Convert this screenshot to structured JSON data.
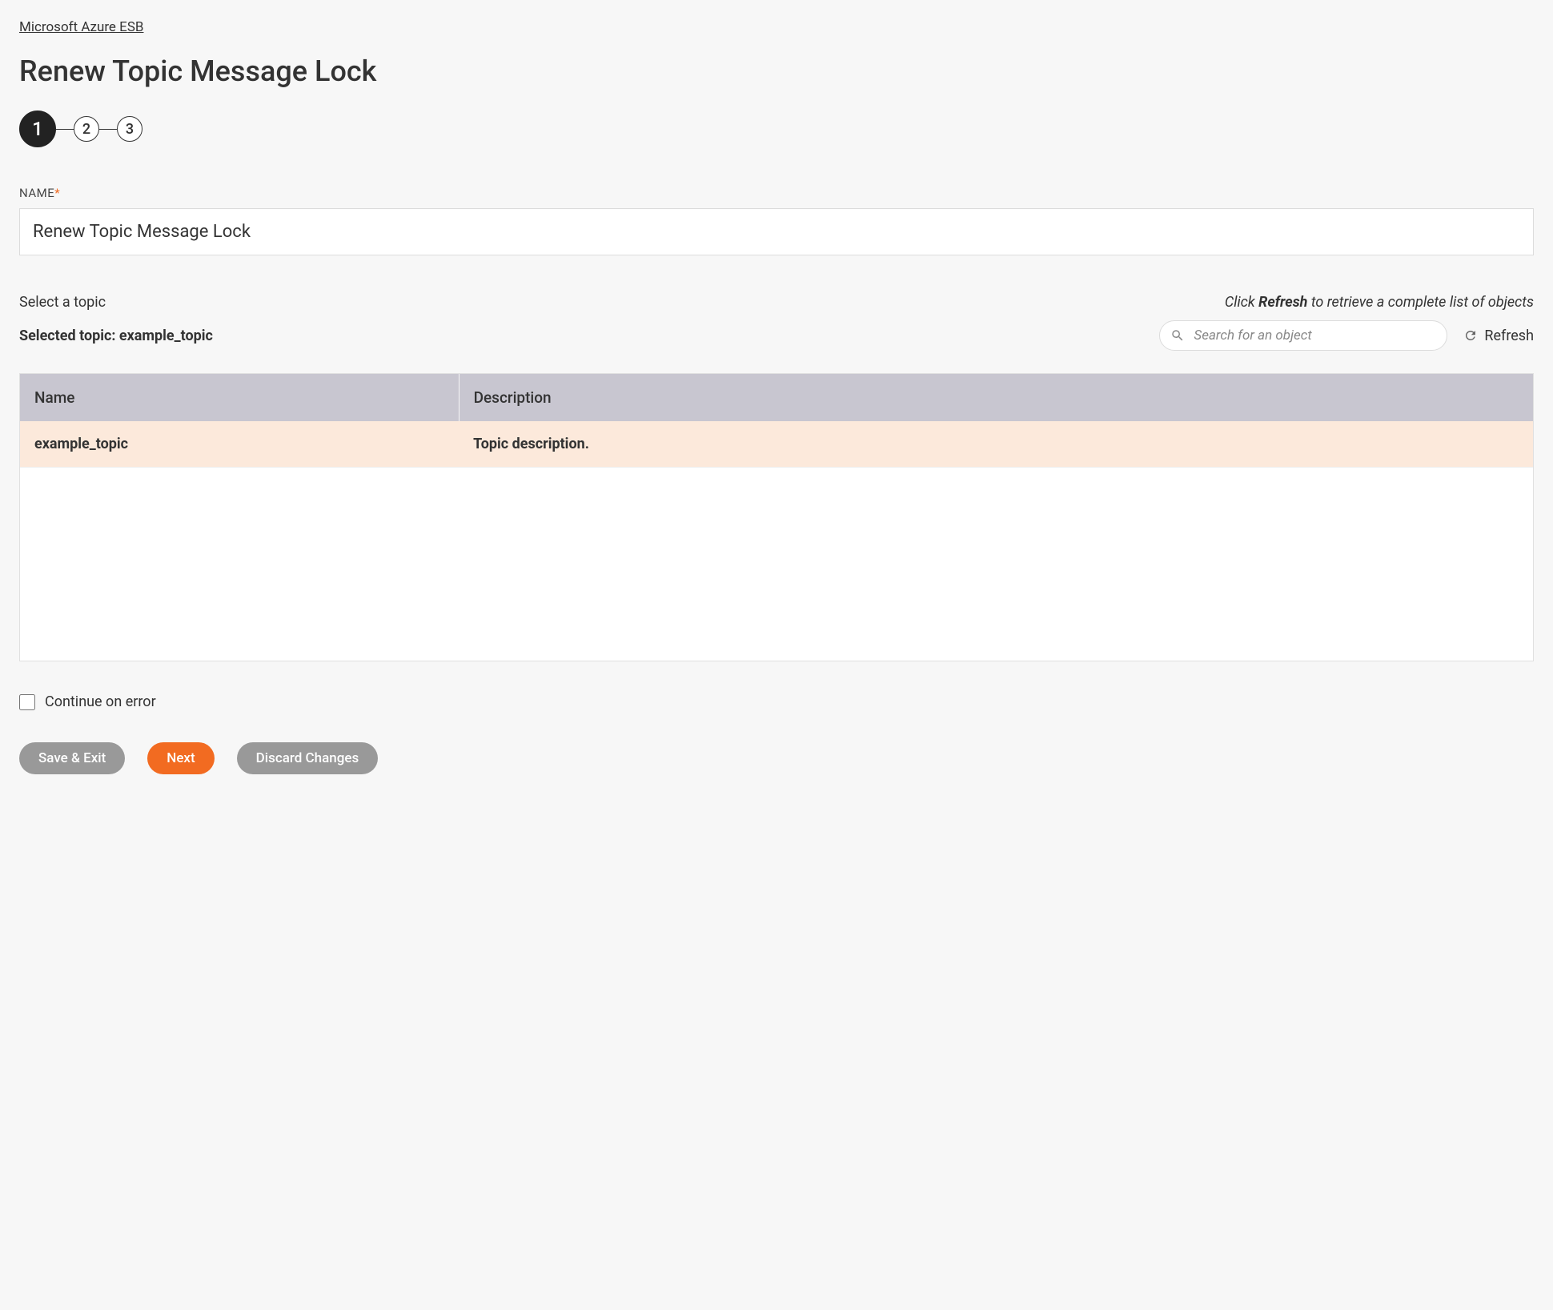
{
  "breadcrumb": {
    "label": "Microsoft Azure ESB"
  },
  "page": {
    "title": "Renew Topic Message Lock"
  },
  "stepper": {
    "steps": [
      "1",
      "2",
      "3"
    ],
    "active_index": 0
  },
  "name_field": {
    "label": "NAME",
    "value": "Renew Topic Message Lock"
  },
  "topic_section": {
    "select_label": "Select a topic",
    "hint_prefix": "Click ",
    "hint_bold": "Refresh",
    "hint_suffix": " to retrieve a complete list of objects",
    "selected_prefix": "Selected topic: ",
    "selected_value": "example_topic",
    "search_placeholder": "Search for an object",
    "refresh_label": "Refresh"
  },
  "table": {
    "headers": {
      "name": "Name",
      "description": "Description"
    },
    "rows": [
      {
        "name": "example_topic",
        "description": "Topic description.",
        "selected": true
      }
    ]
  },
  "continue_on_error": {
    "label": "Continue on error",
    "checked": false
  },
  "footer": {
    "save_exit": "Save & Exit",
    "next": "Next",
    "discard": "Discard Changes"
  }
}
